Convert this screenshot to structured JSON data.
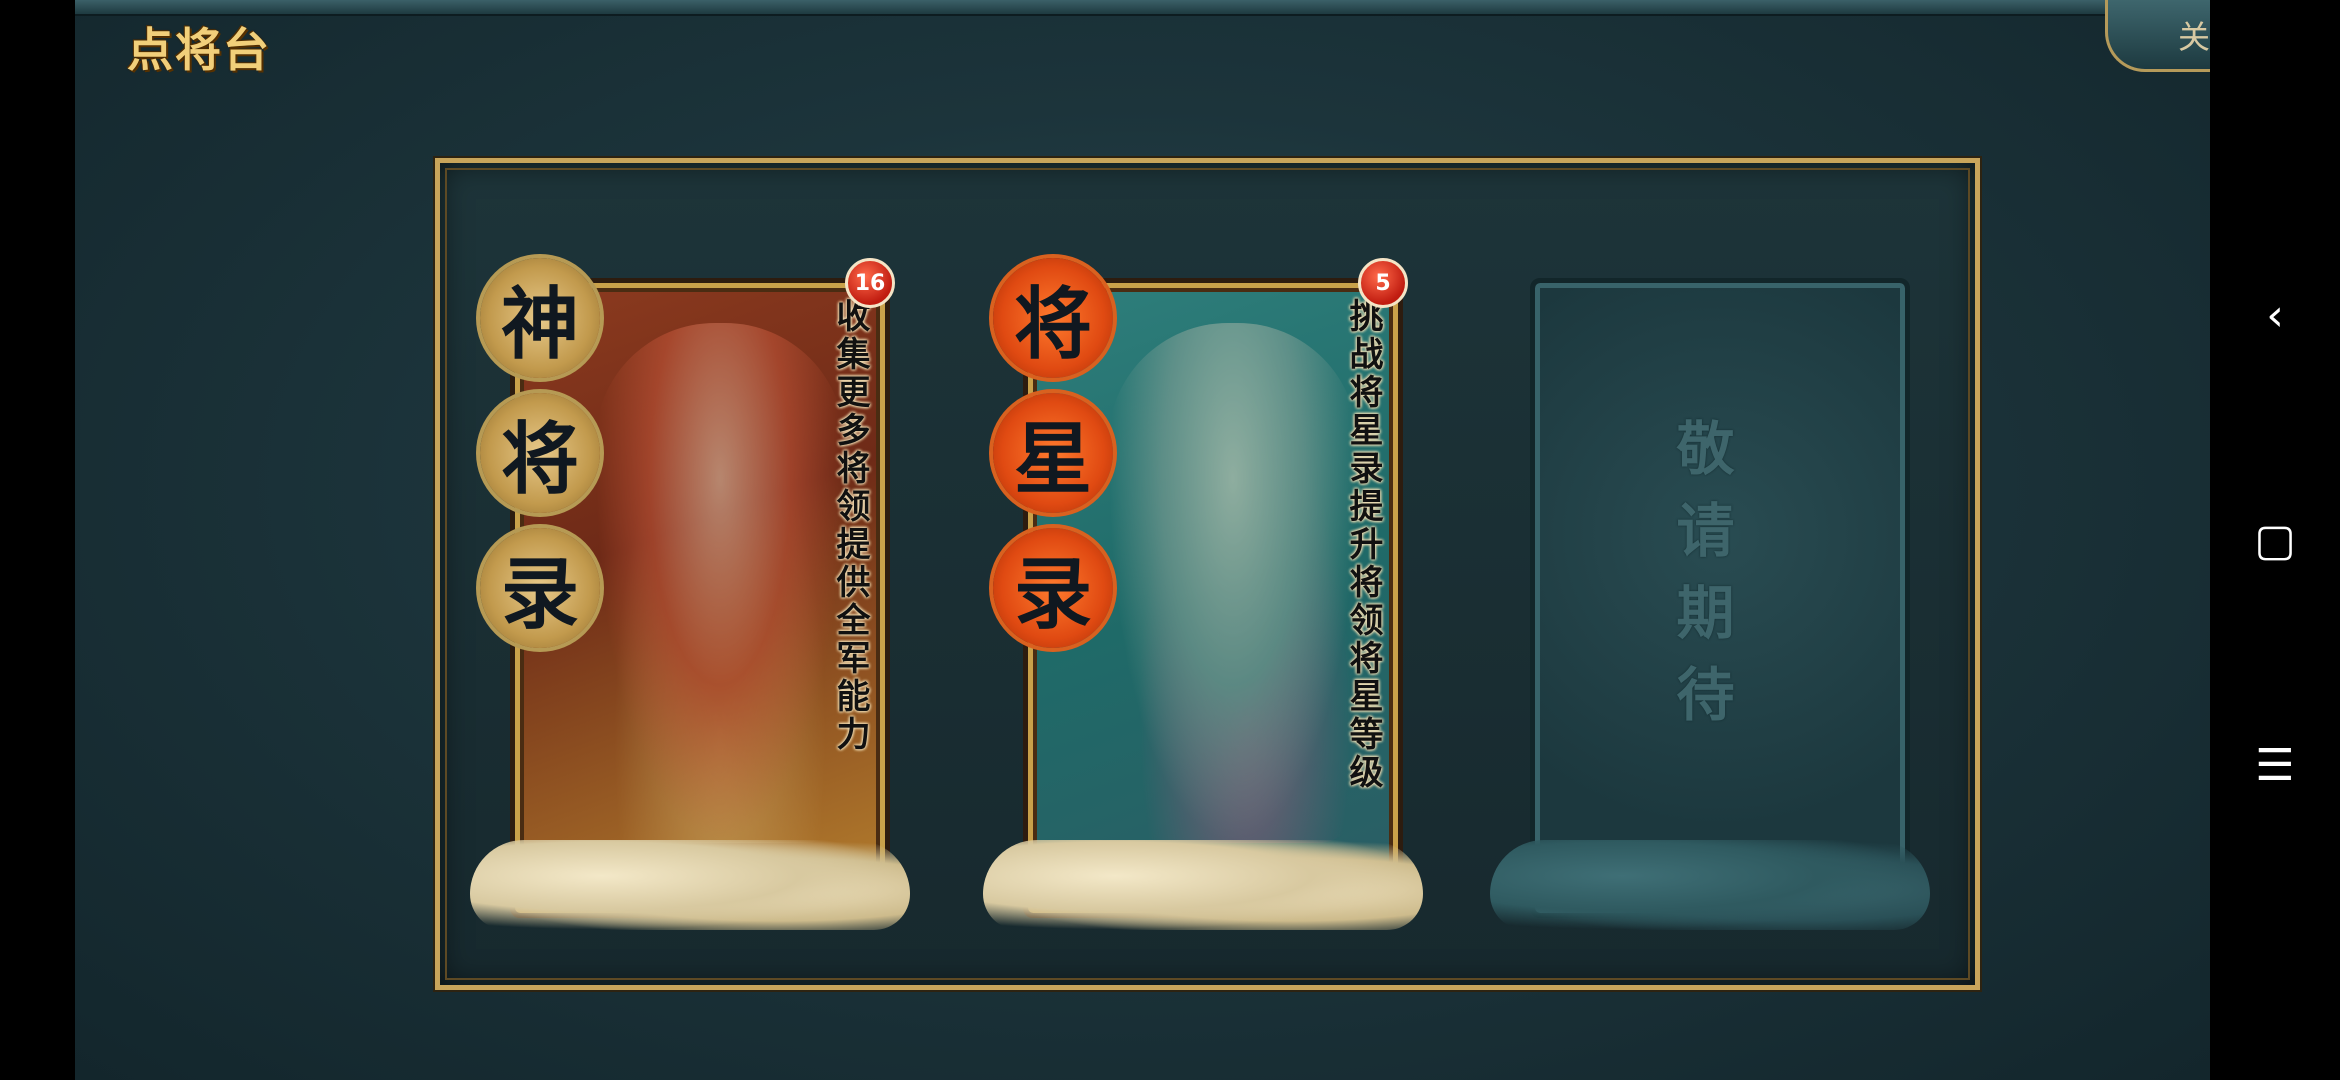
{
  "header": {
    "title": "点将台",
    "close_label": "关闭"
  },
  "cards": [
    {
      "seal_chars": [
        "神",
        "将",
        "录"
      ],
      "badge": "16",
      "description": "收集更多将领提供全军能力"
    },
    {
      "seal_chars": [
        "将",
        "星",
        "录"
      ],
      "badge": "5",
      "description": "挑战将星录提升将领将星等级"
    },
    {
      "coming_soon": "敬请期待"
    }
  ],
  "system_nav": {
    "back_icon": "‹",
    "home_icon": "▢",
    "menu_icon": "☰"
  },
  "colors": {
    "gold_border": "#c8a55b",
    "card1_bg": "#8d3b1f",
    "card2_bg": "#2f7f7c",
    "badge": "#c01c10"
  }
}
